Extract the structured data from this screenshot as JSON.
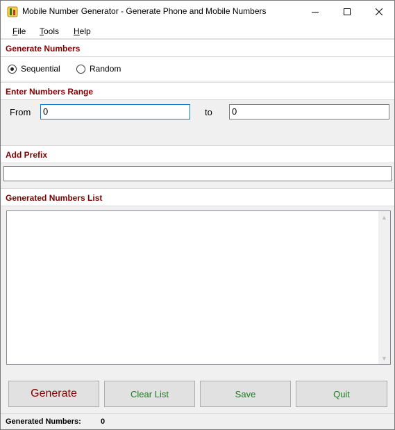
{
  "window": {
    "title": "Mobile Number Generator - Generate Phone and Mobile Numbers",
    "app_icon": "app-icon",
    "controls": [
      "minimize-icon",
      "maximize-icon",
      "close-icon"
    ]
  },
  "menu": {
    "file": "File",
    "tools": "Tools",
    "help": "Help"
  },
  "generate_section": {
    "header": "Generate Numbers",
    "mode_sequential": "Sequential",
    "mode_random": "Random",
    "selected_mode": "Sequential"
  },
  "range_section": {
    "header": "Enter Numbers Range",
    "from_label": "From",
    "from_value": "0",
    "to_label": "to",
    "to_value": "0"
  },
  "prefix_section": {
    "header": "Add Prefix",
    "prefix_value": ""
  },
  "list_section": {
    "header": "Generated Numbers List",
    "items": []
  },
  "buttons": {
    "generate": "Generate",
    "clear_list": "Clear List",
    "save": "Save",
    "quit": "Quit"
  },
  "status": {
    "label": "Generated Numbers:",
    "count": "0"
  },
  "colors": {
    "section_header": "#800000",
    "button_text": "#1e7b1e",
    "generate_text": "#800000",
    "focus_border": "#0078d7"
  }
}
